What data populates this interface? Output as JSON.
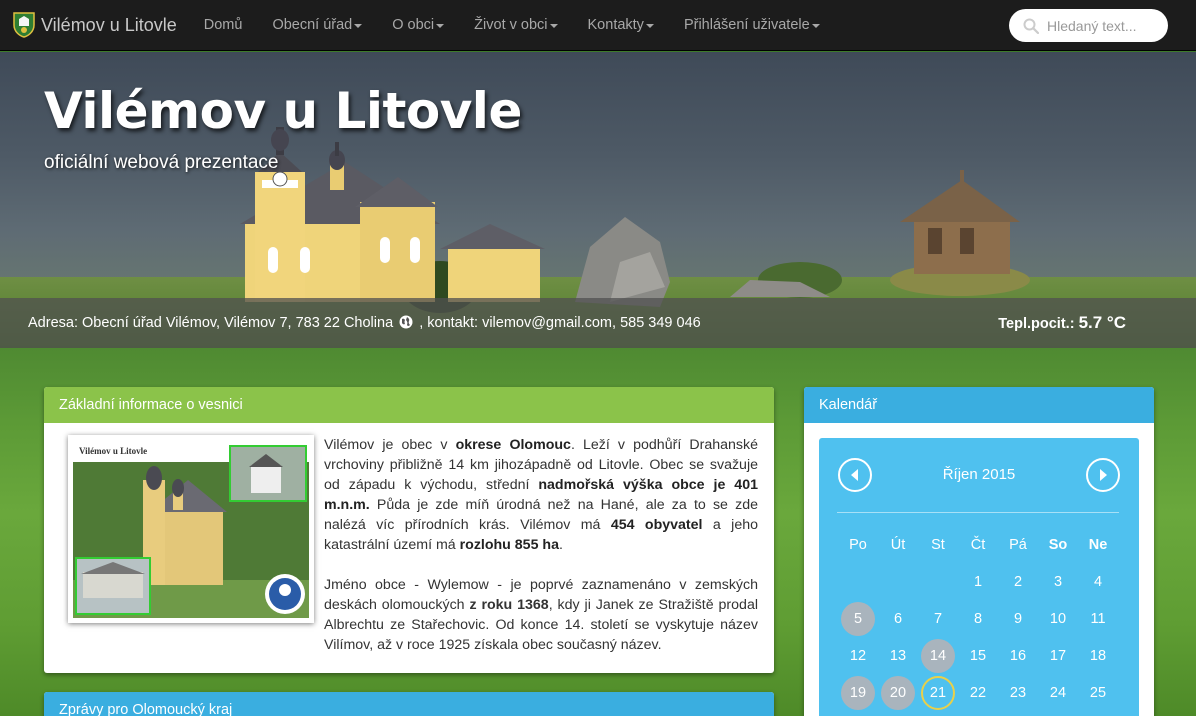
{
  "navbar": {
    "brand": "Vilémov u Litovle",
    "items": [
      {
        "label": "Domů",
        "dropdown": false
      },
      {
        "label": "Obecní úřad",
        "dropdown": true
      },
      {
        "label": "O obci",
        "dropdown": true
      },
      {
        "label": "Život v obci",
        "dropdown": true
      },
      {
        "label": "Kontakty",
        "dropdown": true
      },
      {
        "label": "Přihlášení uživatele",
        "dropdown": true
      }
    ],
    "search_placeholder": "Hledaný text..."
  },
  "hero": {
    "title": "Vilémov u Litovle",
    "subtitle": "oficiální webová prezentace",
    "address_prefix": "Adresa: Obecní úřad Vilémov, Vilémov 7, 783 22 Cholina",
    "address_suffix": ", kontakt: vilemov@gmail.com, 585 349 046",
    "temp_label": "Tepl.pocit.:",
    "temp_value": "5.7 °C"
  },
  "info_panel": {
    "title": "Základní informace o vesnici",
    "photo_caption": "Vilémov u Litovle",
    "p1": [
      {
        "t": "Vilémov je obec v ",
        "b": false
      },
      {
        "t": "okrese Olomouc",
        "b": true
      },
      {
        "t": ". Leží v podhůří Drahanské vrchoviny přibližně 14 km jihozápadně od Litovle. Obec se svažuje od západu k východu, střední ",
        "b": false
      },
      {
        "t": "nadmořská výška obce je 401 m.n.m.",
        "b": true
      },
      {
        "t": " Půda je zde míň úrodná než na Hané, ale za to se zde nalézá víc přírodních krás. Vilémov má ",
        "b": false
      },
      {
        "t": "454 obyvatel",
        "b": true
      },
      {
        "t": " a jeho katastrální území má ",
        "b": false
      },
      {
        "t": "rozlohu 855 ha",
        "b": true
      },
      {
        "t": ".",
        "b": false
      }
    ],
    "p2a": "Jméno obce - Wylemow - je poprvé zaznamenáno v zemských deskách olomouckých ",
    "p2b": "z roku 1368",
    "p2c": ", kdy ji Janek ze Stražiště prodal Albrechtu ze Stařechovic. Od konce 14. století se vyskytuje název Vilímov, až v roce 1925 získala obec současný název."
  },
  "news_panel": {
    "title": "Zprávy pro Olomoucký kraj"
  },
  "calendar": {
    "title": "Kalendář",
    "month": "Říjen 2015",
    "weekdays": [
      {
        "label": "Po",
        "bold": false
      },
      {
        "label": "Út",
        "bold": false
      },
      {
        "label": "St",
        "bold": false
      },
      {
        "label": "Čt",
        "bold": false
      },
      {
        "label": "Pá",
        "bold": false
      },
      {
        "label": "So",
        "bold": true
      },
      {
        "label": "Ne",
        "bold": true
      }
    ],
    "weeks": [
      [
        "",
        "",
        "",
        "1",
        "2",
        "3",
        "4"
      ],
      [
        "5",
        "6",
        "7",
        "8",
        "9",
        "10",
        "11"
      ],
      [
        "12",
        "13",
        "14",
        "15",
        "16",
        "17",
        "18"
      ],
      [
        "19",
        "20",
        "21",
        "22",
        "23",
        "24",
        "25"
      ]
    ],
    "event_days": [
      "5",
      "14",
      "19",
      "20"
    ],
    "today": "21"
  }
}
